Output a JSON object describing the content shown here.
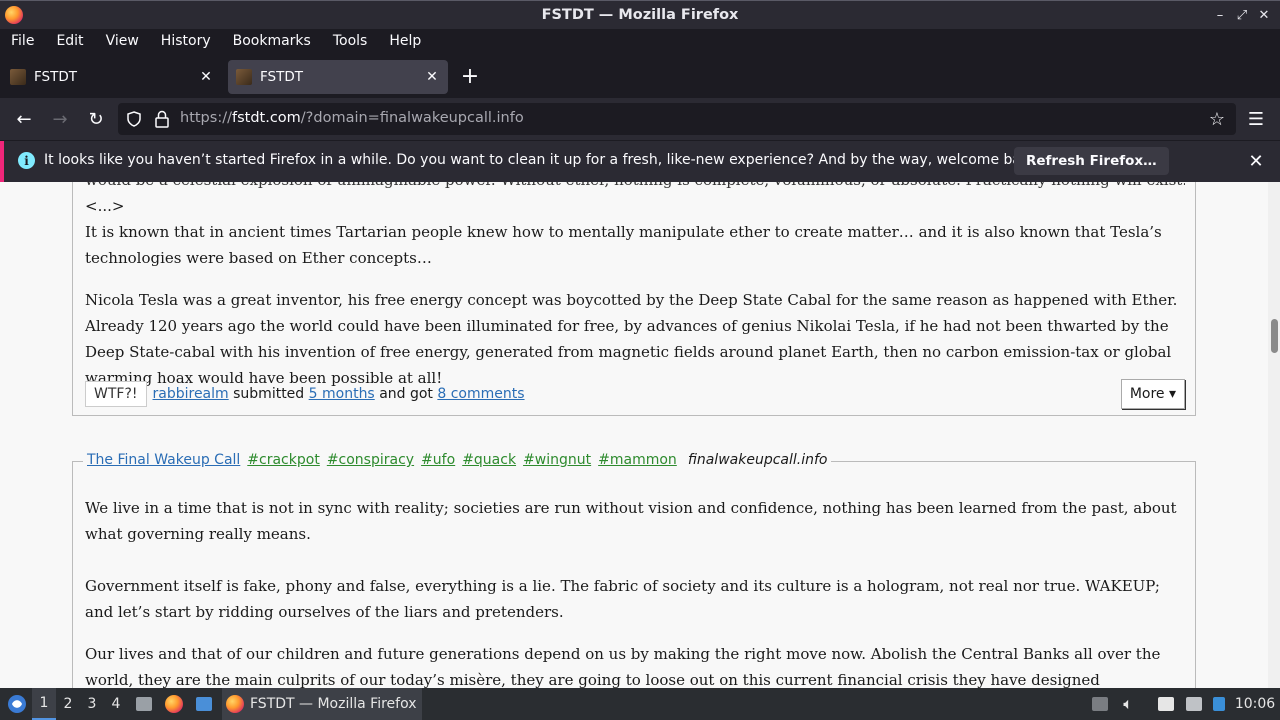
{
  "window": {
    "title": "FSTDT — Mozilla Firefox"
  },
  "menu": [
    "File",
    "Edit",
    "View",
    "History",
    "Bookmarks",
    "Tools",
    "Help"
  ],
  "tabs": [
    {
      "label": "FSTDT",
      "active": false
    },
    {
      "label": "FSTDT",
      "active": true
    }
  ],
  "nav": {
    "url_prefix": "https://",
    "url_host": "fstdt.com",
    "url_rest": "/?domain=finalwakeupcall.info"
  },
  "notification": {
    "message": "It looks like you haven’t started Firefox in a while. Do you want to clean it up for a fresh, like-new experience? And by the way, welcome back!",
    "button": "Refresh Firefox…"
  },
  "post1": {
    "cut_line": "would be a celestial explosion of unimaginable power. Without ether, nothing is complete, voluminous, or absolute. Practically nothing will exist.",
    "ellipsis": "<...>",
    "para1": "It is known that in ancient times Tartarian people knew how to mentally manipulate ether to create matter… and it is also known that Tesla’s technologies were based on Ether concepts…",
    "para2": "Nicola Tesla was a great inventor, his free energy concept was boycotted by the Deep State Cabal for the same reason as happened with Ether. Already 120 years ago the world could have been illuminated for free, by advances of genius Nikolai Tesla, if he had not been thwarted by the Deep State-cabal with his invention of free energy, generated from magnetic fields around planet Earth, then no carbon emission-tax or global warming hoax would have been possible at all!",
    "wtf": "WTF?!",
    "user": "rabbirealm",
    "submitted": "submitted",
    "time": "5 months",
    "and_got": "and got",
    "comments": "8 comments",
    "more": "More ▾"
  },
  "post2": {
    "site": "The Final Wakeup Call",
    "tags": [
      "#crackpot",
      "#conspiracy",
      "#ufo",
      "#quack",
      "#wingnut",
      "#mammon"
    ],
    "domain": "finalwakeupcall.info",
    "para1": "We live in a time that is not in sync with reality; societies are run without vision and confidence, nothing has been learned from the past, about what governing really means.",
    "para2": "Government itself is fake, phony and false, everything is a lie. The fabric of society and its culture is a hologram, not real nor true. WAKEUP; and let’s start by ridding ourselves of the liars and pretenders.",
    "para3": "Our lives and that of our children and future generations depend on us by making the right move now. Abolish the Central Banks all over the world, they are the main culprits of our today’s misère, they are going to loose out on this current financial crisis they have designed themselves. A return to sound money is the first thing necessary"
  },
  "taskbar": {
    "workspaces": [
      "1",
      "2",
      "3",
      "4"
    ],
    "task_label": "FSTDT — Mozilla Firefox",
    "clock": "10:06"
  }
}
